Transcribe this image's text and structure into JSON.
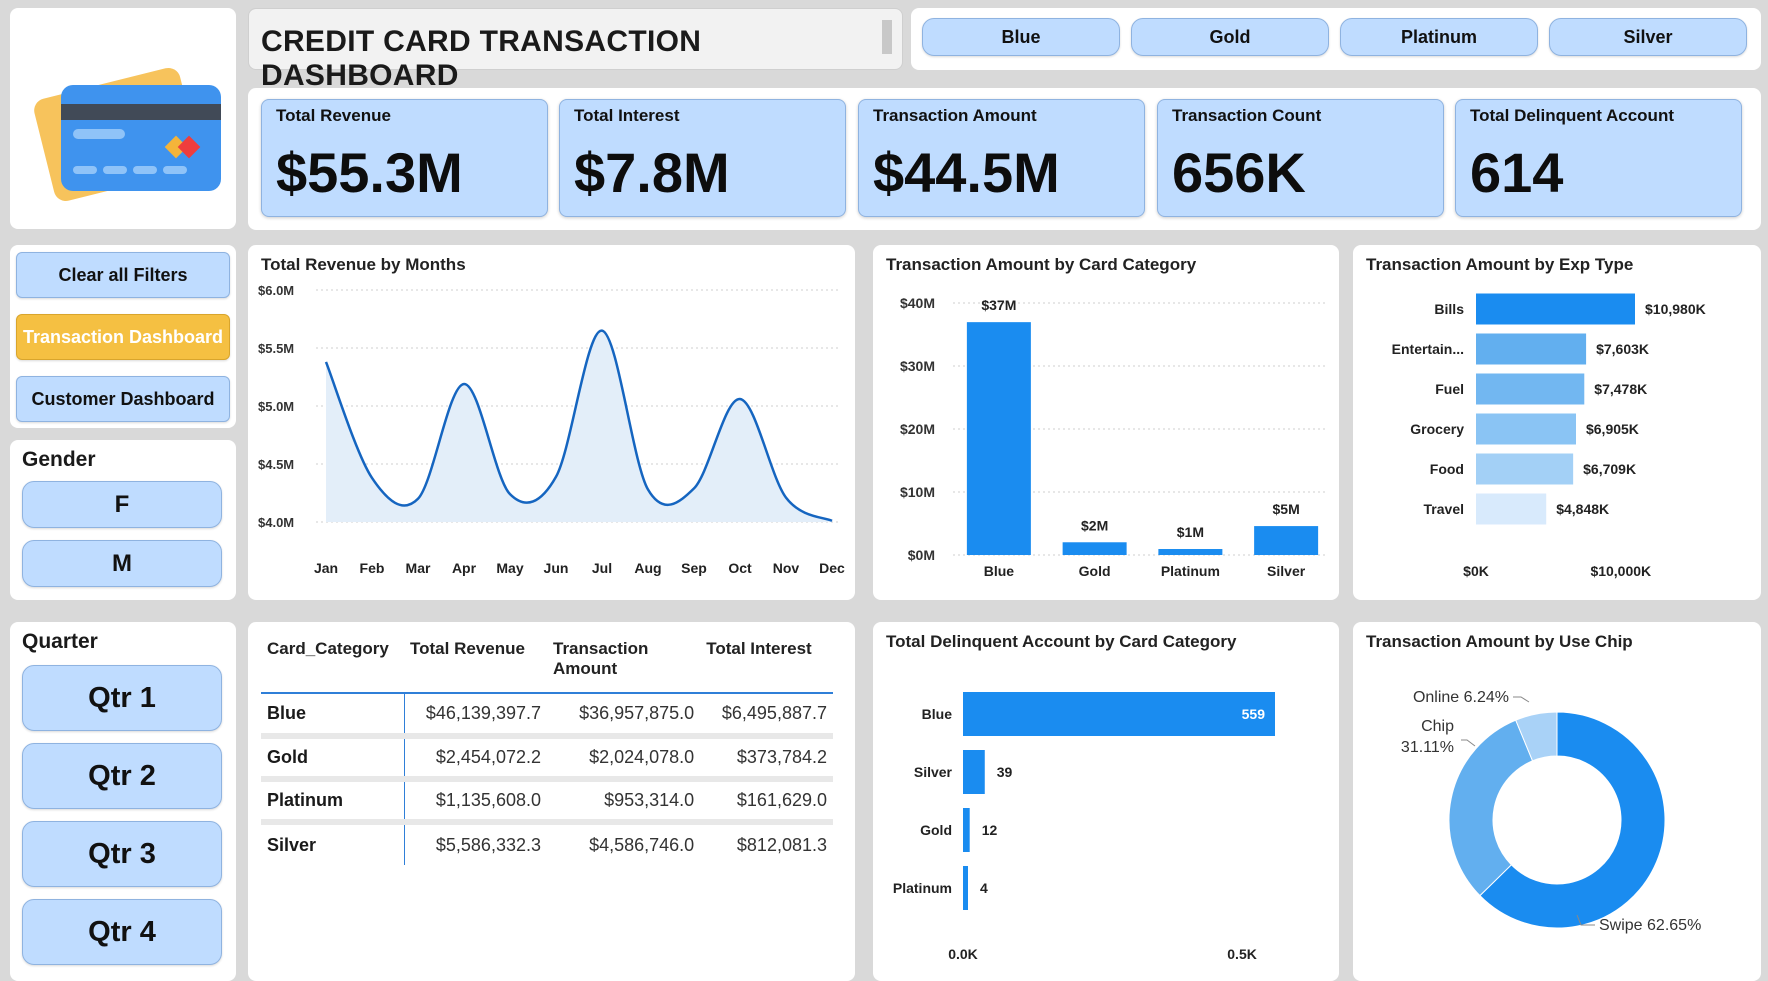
{
  "header": {
    "title": "CREDIT CARD TRANSACTION DASHBOARD",
    "card_filters": [
      "Blue",
      "Gold",
      "Platinum",
      "Silver"
    ]
  },
  "kpis": [
    {
      "label": "Total Revenue",
      "value": "$55.3M"
    },
    {
      "label": "Total Interest",
      "value": "$7.8M"
    },
    {
      "label": "Transaction Amount",
      "value": "$44.5M"
    },
    {
      "label": "Transaction Count",
      "value": "656K"
    },
    {
      "label": "Total Delinquent Account",
      "value": "614"
    }
  ],
  "nav": {
    "clear_filters": "Clear all Filters",
    "transaction_dashboard": "Transaction Dashboard",
    "customer_dashboard": "Customer Dashboard"
  },
  "gender": {
    "title": "Gender",
    "options": [
      "F",
      "M"
    ]
  },
  "quarter": {
    "title": "Quarter",
    "options": [
      "Qtr 1",
      "Qtr 2",
      "Qtr 3",
      "Qtr 4"
    ]
  },
  "colors": {
    "accent": "#1a8cf0",
    "tile": "#bfdcff",
    "active_nav": "#f5c042",
    "area": "#e3eef9",
    "line": "#1565c0"
  },
  "icons": {
    "logo": "credit-card-icon"
  },
  "table": {
    "headers": [
      "Card_Category",
      "Total Revenue",
      "Transaction Amount",
      "Total Interest"
    ],
    "rows": [
      [
        "Blue",
        "$46,139,397.7",
        "$36,957,875.0",
        "$6,495,887.7"
      ],
      [
        "Gold",
        "$2,454,072.2",
        "$2,024,078.0",
        "$373,784.2"
      ],
      [
        "Platinum",
        "$1,135,608.0",
        "$953,314.0",
        "$161,629.0"
      ],
      [
        "Silver",
        "$5,586,332.3",
        "$4,586,746.0",
        "$812,081.3"
      ]
    ]
  },
  "chart_data": [
    {
      "id": "revenue_by_month",
      "type": "area",
      "title": "Total Revenue by Months",
      "categories": [
        "Jan",
        "Feb",
        "Mar",
        "Apr",
        "May",
        "Jun",
        "Jul",
        "Aug",
        "Sep",
        "Oct",
        "Nov",
        "Dec"
      ],
      "values": [
        5.38,
        4.38,
        4.2,
        5.19,
        4.24,
        4.39,
        5.65,
        4.28,
        4.29,
        5.06,
        4.21,
        4.01
      ],
      "unit": "$M",
      "ylim": [
        4.0,
        6.0
      ],
      "yticks": [
        "$4.0M",
        "$4.5M",
        "$5.0M",
        "$5.5M",
        "$6.0M"
      ],
      "grid": true
    },
    {
      "id": "amount_by_card",
      "type": "bar",
      "title": "Transaction Amount by Card Category",
      "categories": [
        "Blue",
        "Gold",
        "Platinum",
        "Silver"
      ],
      "values": [
        36.96,
        2.02,
        0.95,
        4.59
      ],
      "data_labels": [
        "$37M",
        "$2M",
        "$1M",
        "$5M"
      ],
      "ylim": [
        0,
        40
      ],
      "yticks": [
        "$0M",
        "$10M",
        "$20M",
        "$30M",
        "$40M"
      ],
      "grid": true
    },
    {
      "id": "amount_by_exp",
      "type": "bar",
      "orientation": "horizontal",
      "title": "Transaction Amount by Exp Type",
      "categories": [
        "Bills",
        "Entertain...",
        "Fuel",
        "Grocery",
        "Food",
        "Travel"
      ],
      "values": [
        10980,
        7603,
        7478,
        6905,
        6709,
        4848
      ],
      "data_labels": [
        "$10,980K",
        "$7,603K",
        "$7,478K",
        "$6,905K",
        "$6,709K",
        "$4,848K"
      ],
      "xlim": [
        0,
        10980
      ],
      "xticks": [
        "$0K",
        "$10,000K"
      ],
      "colors": [
        "#1a8cf0",
        "#62afef",
        "#72b7f1",
        "#8ac4f4",
        "#a3d0f6",
        "#d8eafc"
      ]
    },
    {
      "id": "delinquent_by_card",
      "type": "bar",
      "orientation": "horizontal",
      "title": "Total Delinquent Account by Card Category",
      "categories": [
        "Blue",
        "Silver",
        "Gold",
        "Platinum"
      ],
      "values": [
        559,
        39,
        12,
        4
      ],
      "xlim": [
        0,
        559
      ],
      "xticks": [
        "0.0K",
        "0.5K"
      ]
    },
    {
      "id": "amount_by_chip",
      "type": "pie",
      "donut": true,
      "title": "Transaction Amount by Use Chip",
      "categories": [
        "Swipe",
        "Chip",
        "Online"
      ],
      "values": [
        62.65,
        31.11,
        6.24
      ],
      "labels": [
        "Swipe 62.65%",
        "Chip",
        "31.11%",
        "Online 6.24%"
      ],
      "colors": [
        "#1a8cf0",
        "#62afef",
        "#a9d2f7"
      ]
    }
  ]
}
